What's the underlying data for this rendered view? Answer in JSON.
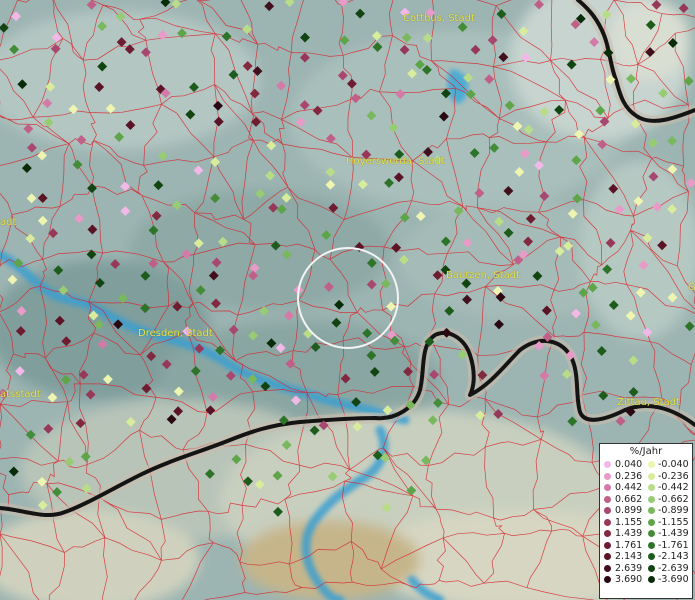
{
  "map": {
    "cities": [
      {
        "name": "Cottbus, Stadt",
        "id": "city-cottbus"
      },
      {
        "name": "Hoyerswerda, Stadt",
        "id": "city-hoyerswerda"
      },
      {
        "name": "Bautzen, Stadt",
        "id": "city-bautzen"
      },
      {
        "name": "Dresden, Stadt",
        "id": "city-dresden"
      },
      {
        "name": "Zittau, Stadt",
        "id": "city-zittau"
      },
      {
        "name": "adt",
        "id": "city-left-fragment"
      },
      {
        "name": "atsstadt",
        "id": "city-left-fragment-2"
      },
      {
        "name": "G",
        "id": "city-right-fragment"
      }
    ],
    "colors": {
      "terrain": "#9fb6b4",
      "border_red": "#d8232a",
      "national_border": "#1a1a1a",
      "river": "#3a9fd0",
      "city_label": "#e8e24a"
    }
  },
  "legend": {
    "title": "%/Jahr",
    "positive": [
      {
        "label": "0.040",
        "color": "#f2b8e8"
      },
      {
        "label": "0.236",
        "color": "#e89ac8"
      },
      {
        "label": "0.442",
        "color": "#d47aa8"
      },
      {
        "label": "0.662",
        "color": "#c06088"
      },
      {
        "label": "0.899",
        "color": "#a84870"
      },
      {
        "label": "1.155",
        "color": "#983858"
      },
      {
        "label": "1.439",
        "color": "#82283f"
      },
      {
        "label": "1.761",
        "color": "#6e1c32"
      },
      {
        "label": "2.143",
        "color": "#5a1426"
      },
      {
        "label": "2.639",
        "color": "#40101c"
      },
      {
        "label": "3.690",
        "color": "#2a0812"
      }
    ],
    "negative": [
      {
        "label": "-0.040",
        "color": "#eef5b0"
      },
      {
        "label": "-0.236",
        "color": "#d8ec9c"
      },
      {
        "label": "-0.442",
        "color": "#b8dc88"
      },
      {
        "label": "-0.662",
        "color": "#98cc74"
      },
      {
        "label": "-0.899",
        "color": "#7ab85e"
      },
      {
        "label": "-1.155",
        "color": "#5ea448"
      },
      {
        "label": "-1.439",
        "color": "#448c38"
      },
      {
        "label": "-1.761",
        "color": "#2e7428"
      },
      {
        "label": "-2.143",
        "color": "#1e5c1c"
      },
      {
        "label": "-2.639",
        "color": "#124412"
      },
      {
        "label": "-3.690",
        "color": "#082c08"
      }
    ]
  }
}
